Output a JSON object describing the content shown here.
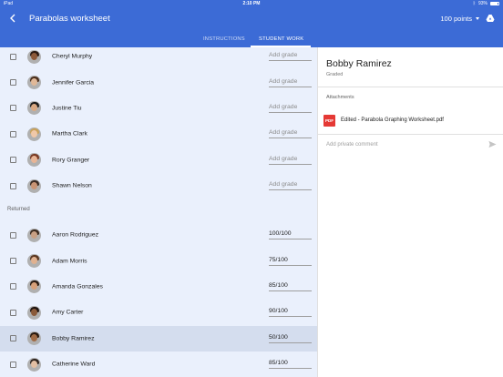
{
  "statusbar": {
    "device": "iPad",
    "time": "2:10 PM",
    "battery": "93%"
  },
  "appbar": {
    "title": "Parabolas worksheet",
    "points": "100 points",
    "tabs": [
      {
        "label": "INSTRUCTIONS",
        "active": false
      },
      {
        "label": "STUDENT WORK",
        "active": true
      }
    ]
  },
  "students_not_graded": [
    {
      "name": "Cheryl Murphy",
      "grade": "Add grade",
      "skin": "#8d5a3a",
      "hair": "#2b1a12"
    },
    {
      "name": "Jennifer Garcia",
      "grade": "Add grade",
      "skin": "#e0b898",
      "hair": "#4a2e1c"
    },
    {
      "name": "Justine Tiu",
      "grade": "Add grade",
      "skin": "#d9a882",
      "hair": "#1b1b1b"
    },
    {
      "name": "Martha Clark",
      "grade": "Add grade",
      "skin": "#f0c8a8",
      "hair": "#c9a15a"
    },
    {
      "name": "Rory Granger",
      "grade": "Add grade",
      "skin": "#e8b596",
      "hair": "#7a3a24"
    },
    {
      "name": "Shawn Nelson",
      "grade": "Add grade",
      "skin": "#c99474",
      "hair": "#3a2a22"
    }
  ],
  "returned_label": "Returned",
  "students_returned": [
    {
      "name": "Aaron Rodriguez",
      "grade": "100/100",
      "skin": "#c8a084",
      "hair": "#3b2b20",
      "selected": false
    },
    {
      "name": "Adam Morris",
      "grade": "75/100",
      "skin": "#e0b190",
      "hair": "#5a3620",
      "selected": false
    },
    {
      "name": "Amanda Gonzales",
      "grade": "85/100",
      "skin": "#d7a079",
      "hair": "#2a1b12",
      "selected": false
    },
    {
      "name": "Amy Carter",
      "grade": "90/100",
      "skin": "#8a5a3a",
      "hair": "#1e1410",
      "selected": false
    },
    {
      "name": "Bobby Ramirez",
      "grade": "50/100",
      "skin": "#a06b45",
      "hair": "#2a1a10",
      "selected": true
    },
    {
      "name": "Catherine Ward",
      "grade": "85/100",
      "skin": "#e3bfa3",
      "hair": "#2f2520",
      "selected": false
    }
  ],
  "detail": {
    "name": "Bobby Ramirez",
    "status": "Graded",
    "attachments_label": "Attachments",
    "file_icon_label": "PDF",
    "file_name": "Edited - Parabola Graphing Worksheet.pdf",
    "comment_placeholder": "Add private comment"
  },
  "colors": {
    "primary": "#3c6bd6",
    "list_bg": "#eaf0fc",
    "selected_row": "#d4ddee",
    "pdf": "#e53935"
  },
  "icons": [
    "back-arrow-icon",
    "dropdown-caret-icon",
    "drive-icon",
    "pdf-icon",
    "send-icon"
  ]
}
